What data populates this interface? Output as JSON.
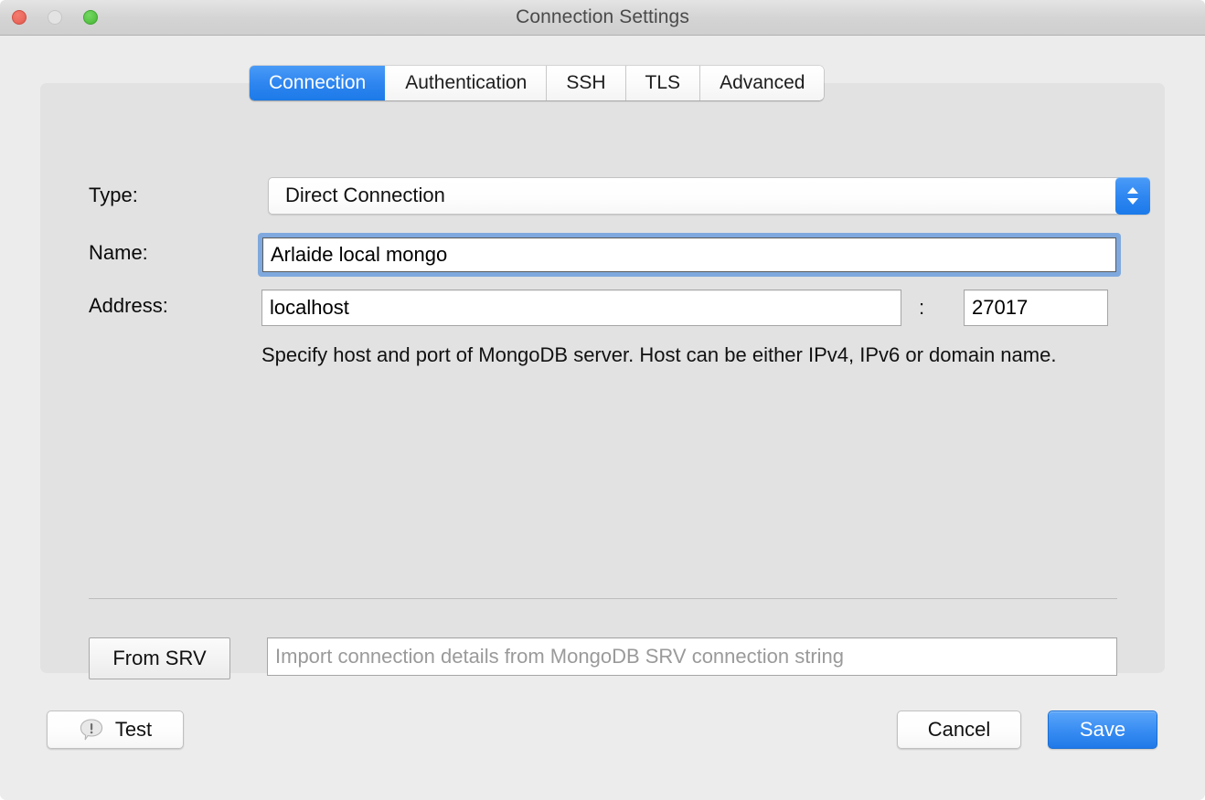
{
  "window": {
    "title": "Connection Settings",
    "traffic_lights": [
      {
        "name": "close",
        "color": "#ec6a5e"
      },
      {
        "name": "minimize",
        "color": "#e3e3e3"
      },
      {
        "name": "zoom",
        "color": "#5bc649"
      }
    ]
  },
  "tabs": [
    {
      "label": "Connection",
      "selected": true
    },
    {
      "label": "Authentication",
      "selected": false
    },
    {
      "label": "SSH",
      "selected": false
    },
    {
      "label": "TLS",
      "selected": false
    },
    {
      "label": "Advanced",
      "selected": false
    }
  ],
  "form": {
    "type": {
      "label": "Type:",
      "value": "Direct Connection",
      "stepper_icon": "chevron-up-down-icon"
    },
    "name": {
      "label": "Name:",
      "value": "Arlaide local mongo",
      "focused": true
    },
    "address": {
      "label": "Address:",
      "host": "localhost",
      "separator": ":",
      "port": "27017"
    },
    "hint": "Specify host and port of MongoDB server. Host can be either IPv4, IPv6 or domain name."
  },
  "srv": {
    "button_label": "From SRV",
    "input_value": "",
    "input_placeholder": "Import connection details from MongoDB SRV connection string"
  },
  "footer": {
    "test_label": "Test",
    "test_icon": "exclamation-bubble-icon",
    "cancel_label": "Cancel",
    "save_label": "Save"
  },
  "colors": {
    "accent_blue": "#2f86f0",
    "focus_ring": "#7fa9de",
    "window_bg": "#ececec",
    "panel_bg": "#e2e2e2"
  }
}
